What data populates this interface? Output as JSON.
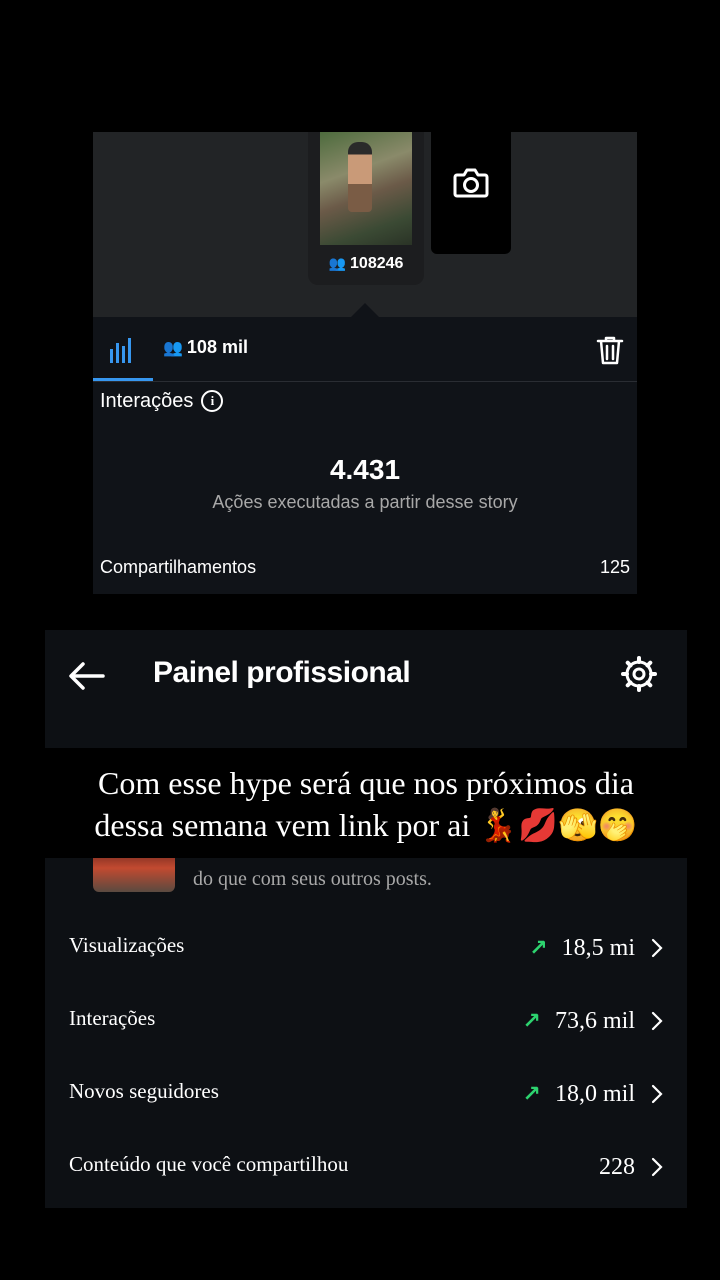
{
  "story": {
    "thumbnail_views": "108246",
    "reach_tab": "108 mil",
    "section_title": "Interações",
    "interactions_total": "4.431",
    "interactions_subtitle": "Ações executadas a partir desse story",
    "shares_label": "Compartilhamentos",
    "shares_value": "125",
    "accent_color": "#3797f0"
  },
  "panel": {
    "title": "Painel profissional",
    "partial_text": "do que com seus outros posts.",
    "metrics": [
      {
        "label": "Visualizações",
        "value": "18,5 mi",
        "trend": "up"
      },
      {
        "label": "Interações",
        "value": "73,6 mil",
        "trend": "up"
      },
      {
        "label": "Novos seguidores",
        "value": "18,0 mil",
        "trend": "up"
      },
      {
        "label": "Conteúdo que você compartilhou",
        "value": "228",
        "trend": "none"
      }
    ],
    "trend_color": "#2dd36f"
  },
  "caption": {
    "line1": "Com esse hype será que nos próximos dia",
    "line2_text": "dessa semana vem link por ai",
    "line2_emojis": "💃💋🫣🤭"
  }
}
